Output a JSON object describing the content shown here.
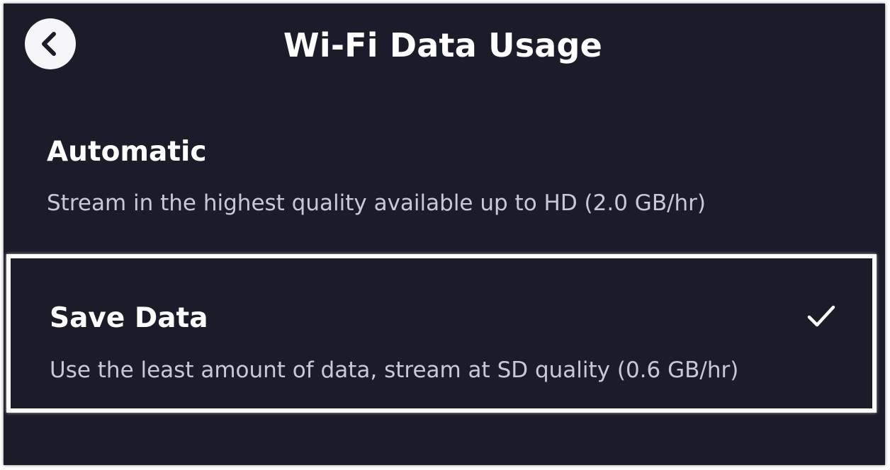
{
  "header": {
    "title": "Wi-Fi Data Usage",
    "back_icon": "chevron-left-icon"
  },
  "options": [
    {
      "title": "Automatic",
      "description": "Stream in the highest quality available up to HD (2.0 GB/hr)",
      "selected": false
    },
    {
      "title": "Save Data",
      "description": "Use the least amount of data, stream at SD quality (0.6 GB/hr)",
      "selected": true,
      "selected_icon": "checkmark-icon"
    }
  ],
  "colors": {
    "background": "#1b1c29",
    "text_primary": "#ffffff",
    "text_secondary": "#c9cad1",
    "focus_border": "#ffffff"
  }
}
